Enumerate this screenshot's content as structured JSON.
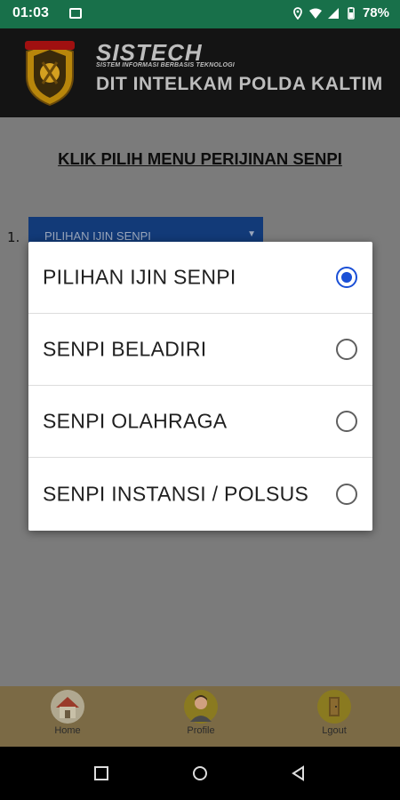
{
  "status_bar": {
    "time": "01:03",
    "battery": "78%"
  },
  "header": {
    "brand": "SISTECH",
    "brand_subtitle": "SISTEM INFORMASI BERBASIS TEKNOLOGI",
    "org": "DIT INTELKAM POLDA KALTIM"
  },
  "main": {
    "title": "KLIK PILIH MENU PERIJINAN SENPI",
    "row_number": "1.",
    "spinner_label": "PILIHAN IJIN SENPI"
  },
  "dialog": {
    "options": [
      {
        "label": "PILIHAN IJIN SENPI",
        "selected": true
      },
      {
        "label": "SENPI BELADIRI",
        "selected": false
      },
      {
        "label": "SENPI OLAHRAGA",
        "selected": false
      },
      {
        "label": "SENPI INSTANSI / POLSUS",
        "selected": false
      }
    ]
  },
  "bottom_nav": {
    "items": [
      {
        "label": "Home",
        "icon": "home-icon"
      },
      {
        "label": "Profile",
        "icon": "profile-icon"
      },
      {
        "label": "Lgout",
        "icon": "logout-icon"
      }
    ]
  },
  "colors": {
    "status_bar": "#18704a",
    "header_bg": "#141414",
    "spinner_bg": "#123a78",
    "radio_accent": "#1a4fd6"
  }
}
